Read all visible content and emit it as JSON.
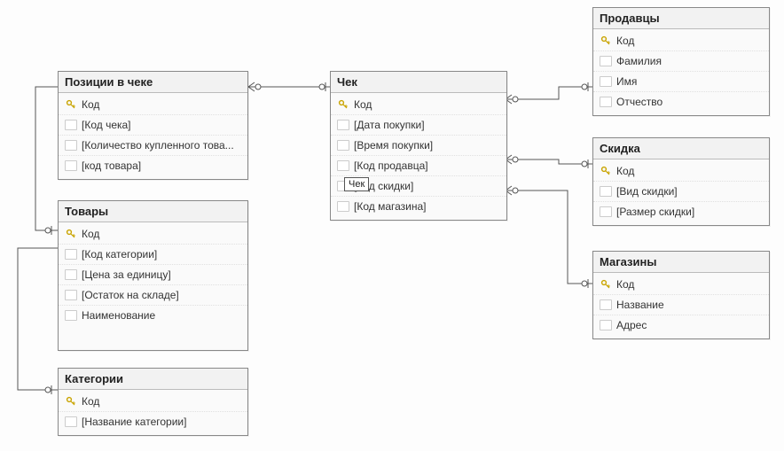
{
  "tables": {
    "positions": {
      "title": "Позиции в чеке",
      "fields": [
        {
          "key": true,
          "label": "Код"
        },
        {
          "key": false,
          "label": "[Код чека]"
        },
        {
          "key": false,
          "label": "[Количество купленного това..."
        },
        {
          "key": false,
          "label": "[код товара]"
        }
      ]
    },
    "goods": {
      "title": "Товары",
      "fields": [
        {
          "key": true,
          "label": "Код"
        },
        {
          "key": false,
          "label": "[Код категории]"
        },
        {
          "key": false,
          "label": "[Цена за единицу]"
        },
        {
          "key": false,
          "label": "[Остаток на складе]"
        },
        {
          "key": false,
          "label": "Наименование"
        }
      ]
    },
    "categories": {
      "title": "Категории",
      "fields": [
        {
          "key": true,
          "label": "Код"
        },
        {
          "key": false,
          "label": "[Название категории]"
        }
      ]
    },
    "check": {
      "title": "Чек",
      "fields": [
        {
          "key": true,
          "label": "Код"
        },
        {
          "key": false,
          "label": "[Дата покупки]"
        },
        {
          "key": false,
          "label": "[Время покупки]"
        },
        {
          "key": false,
          "label": "[Код продавца]"
        },
        {
          "key": false,
          "label": "[Код скидки]"
        },
        {
          "key": false,
          "label": "[Код магазина]"
        }
      ]
    },
    "sellers": {
      "title": "Продавцы",
      "fields": [
        {
          "key": true,
          "label": "Код"
        },
        {
          "key": false,
          "label": "Фамилия"
        },
        {
          "key": false,
          "label": "Имя"
        },
        {
          "key": false,
          "label": "Отчество"
        }
      ]
    },
    "discount": {
      "title": "Скидка",
      "fields": [
        {
          "key": true,
          "label": "Код"
        },
        {
          "key": false,
          "label": "[Вид скидки]"
        },
        {
          "key": false,
          "label": "[Размер скидки]"
        }
      ]
    },
    "stores": {
      "title": "Магазины",
      "fields": [
        {
          "key": true,
          "label": "Код"
        },
        {
          "key": false,
          "label": "Название"
        },
        {
          "key": false,
          "label": "Адрес"
        }
      ]
    }
  },
  "tooltip": {
    "text": "Чек"
  },
  "chart_data": {
    "type": "table",
    "description": "Database relationship diagram (ER-style)",
    "entities": [
      {
        "name": "Позиции в чеке",
        "primary_key": "Код",
        "fields": [
          "Код",
          "[Код чека]",
          "[Количество купленного товара]",
          "[код товара]"
        ]
      },
      {
        "name": "Товары",
        "primary_key": "Код",
        "fields": [
          "Код",
          "[Код категории]",
          "[Цена за единицу]",
          "[Остаток на складе]",
          "Наименование"
        ]
      },
      {
        "name": "Категории",
        "primary_key": "Код",
        "fields": [
          "Код",
          "[Название категории]"
        ]
      },
      {
        "name": "Чек",
        "primary_key": "Код",
        "fields": [
          "Код",
          "[Дата покупки]",
          "[Время покупки]",
          "[Код продавца]",
          "[Код скидки]",
          "[Код магазина]"
        ]
      },
      {
        "name": "Продавцы",
        "primary_key": "Код",
        "fields": [
          "Код",
          "Фамилия",
          "Имя",
          "Отчество"
        ]
      },
      {
        "name": "Скидка",
        "primary_key": "Код",
        "fields": [
          "Код",
          "[Вид скидки]",
          "[Размер скидки]"
        ]
      },
      {
        "name": "Магазины",
        "primary_key": "Код",
        "fields": [
          "Код",
          "Название",
          "Адрес"
        ]
      }
    ],
    "relationships": [
      {
        "from": "Позиции в чеке",
        "to": "Чек",
        "type": "many-to-one"
      },
      {
        "from": "Позиции в чеке",
        "to": "Товары",
        "type": "many-to-one"
      },
      {
        "from": "Товары",
        "to": "Категории",
        "type": "many-to-one"
      },
      {
        "from": "Чек",
        "to": "Продавцы",
        "type": "many-to-one"
      },
      {
        "from": "Чек",
        "to": "Скидка",
        "type": "many-to-one"
      },
      {
        "from": "Чек",
        "to": "Магазины",
        "type": "many-to-one"
      }
    ]
  }
}
